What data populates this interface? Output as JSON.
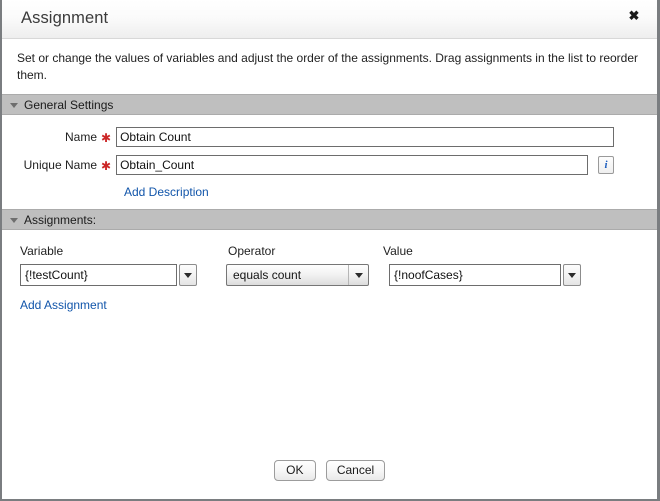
{
  "dialog": {
    "title": "Assignment",
    "close_icon": "close-icon",
    "close_glyph": "✖",
    "description": "Set or change the values of variables and adjust the order of the assignments. Drag assignments in the list to reorder them."
  },
  "general_settings": {
    "header": "General Settings",
    "collapsed": false,
    "name": {
      "label": "Name",
      "required_marker": "✱",
      "value": "Obtain Count",
      "placeholder": ""
    },
    "unique_name": {
      "label": "Unique Name",
      "required_marker": "✱",
      "value": "Obtain_Count",
      "placeholder": "",
      "info_button": "i"
    },
    "add_description_link": "Add Description"
  },
  "assignments": {
    "header": "Assignments:",
    "collapsed": false,
    "columns": {
      "variable": "Variable",
      "operator": "Operator",
      "value": "Value"
    },
    "rows": [
      {
        "variable": "{!testCount}",
        "operator": "equals count",
        "value": "{!noofCases}"
      }
    ],
    "add_assignment_link": "Add Assignment"
  },
  "footer": {
    "ok_label": "OK",
    "cancel_label": "Cancel"
  },
  "colors": {
    "section_header_bg": "#bfbfbf",
    "required_marker": "#cc2727",
    "link": "#1155aa",
    "dialog_border": "#7a7d80",
    "info_icon": "#1f5fbf"
  }
}
